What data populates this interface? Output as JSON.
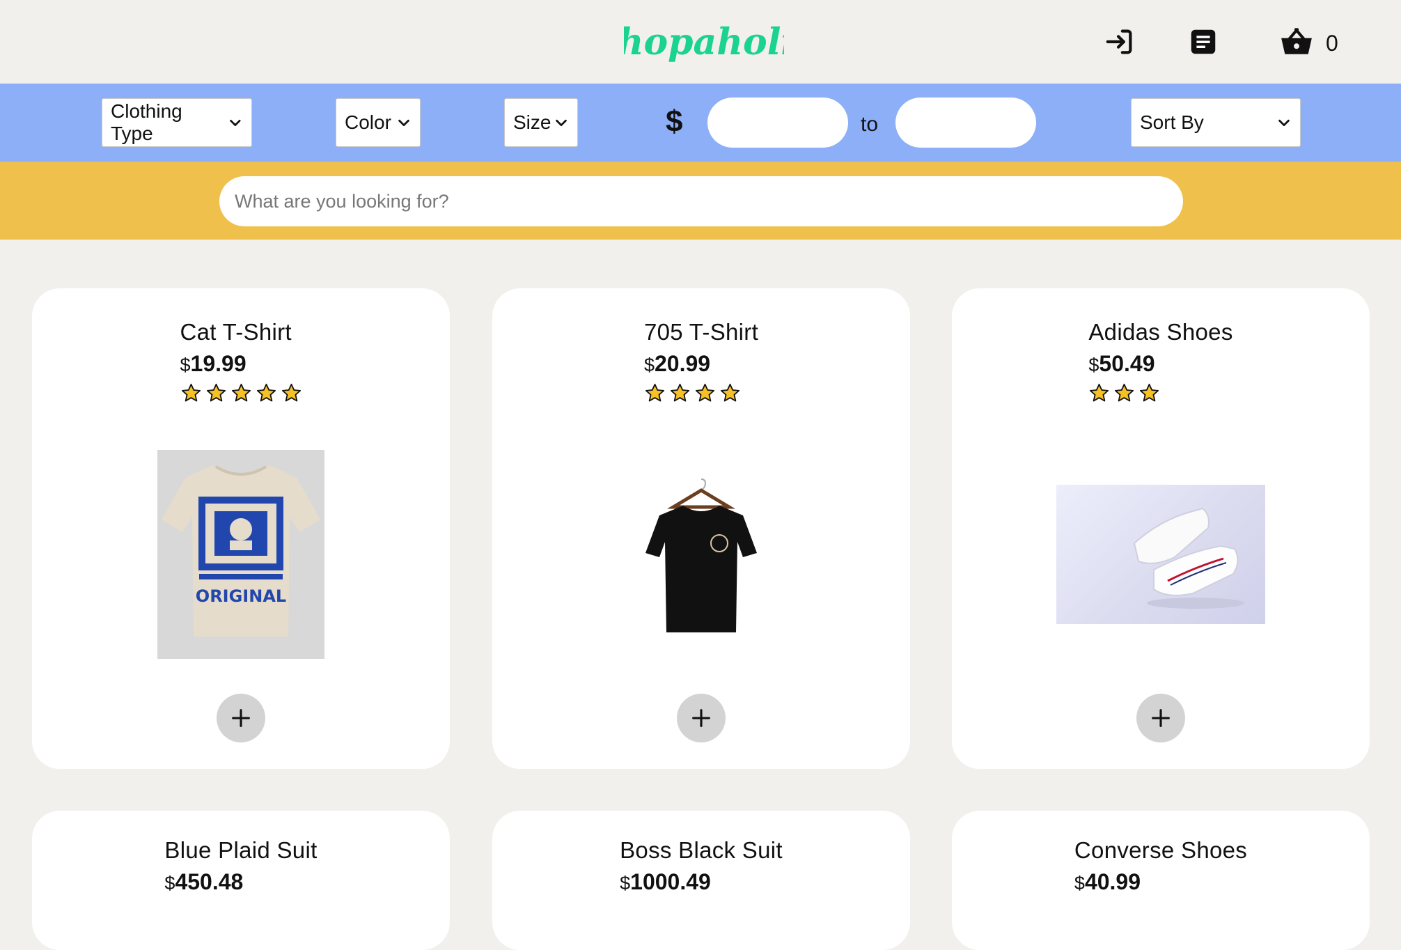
{
  "header": {
    "logo_text": "Shopaholic",
    "login_icon": "login-arrow-icon",
    "orders_icon": "document-icon",
    "cart_icon": "basket-icon",
    "cart_count": "0",
    "logo_color": "#19d38f"
  },
  "filters": {
    "clothing_type": "Clothing Type",
    "color": "Color",
    "size": "Size",
    "currency_symbol": "$",
    "price_min": "",
    "price_to_label": "to",
    "price_max": "",
    "sort_by": "Sort By",
    "bar_color": "#8daff7"
  },
  "search": {
    "placeholder": "What are you looking for?",
    "value": "",
    "bar_color": "#efc04c"
  },
  "products": [
    {
      "name": "Cat T-Shirt",
      "currency": "$",
      "price": "19.99",
      "rating": 5
    },
    {
      "name": "705 T-Shirt",
      "currency": "$",
      "price": "20.99",
      "rating": 4
    },
    {
      "name": "Adidas Shoes",
      "currency": "$",
      "price": "50.49",
      "rating": 3
    },
    {
      "name": "Blue Plaid Suit",
      "currency": "$",
      "price": "450.48"
    },
    {
      "name": "Boss Black Suit",
      "currency": "$",
      "price": "1000.49"
    },
    {
      "name": "Converse Shoes",
      "currency": "$",
      "price": "40.99"
    }
  ],
  "product_images": {
    "cat_tshirt_print": "ORIGINAL"
  }
}
